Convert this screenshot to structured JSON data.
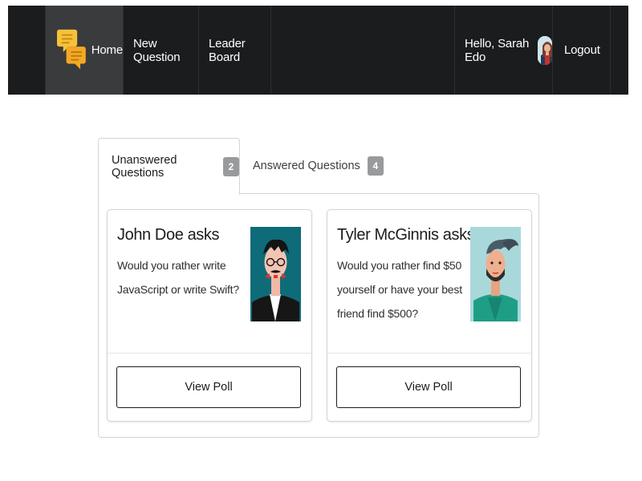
{
  "nav": {
    "home": "Home",
    "new_question": "New Question",
    "leader_board": "Leader Board",
    "greeting": "Hello, Sarah Edo",
    "logout": "Logout",
    "logo_icon": "speech-bubbles-icon"
  },
  "tabs": [
    {
      "label": "Unanswered Questions",
      "count": "2"
    },
    {
      "label": "Answered Questions",
      "count": "4"
    }
  ],
  "questions": [
    {
      "header": "John Doe asks",
      "text": "Would you rather write JavaScript or write Swift?",
      "button": "View Poll"
    },
    {
      "header": "Tyler McGinnis asks",
      "text": "Would you rather find $50 yourself or have your best friend find $500?",
      "button": "View Poll"
    }
  ],
  "colors": {
    "navbar": "#1b1c1d",
    "nav_active": "#3a3b3c",
    "badge": "#999a9b",
    "logo_yellow": "#f7c23a"
  }
}
